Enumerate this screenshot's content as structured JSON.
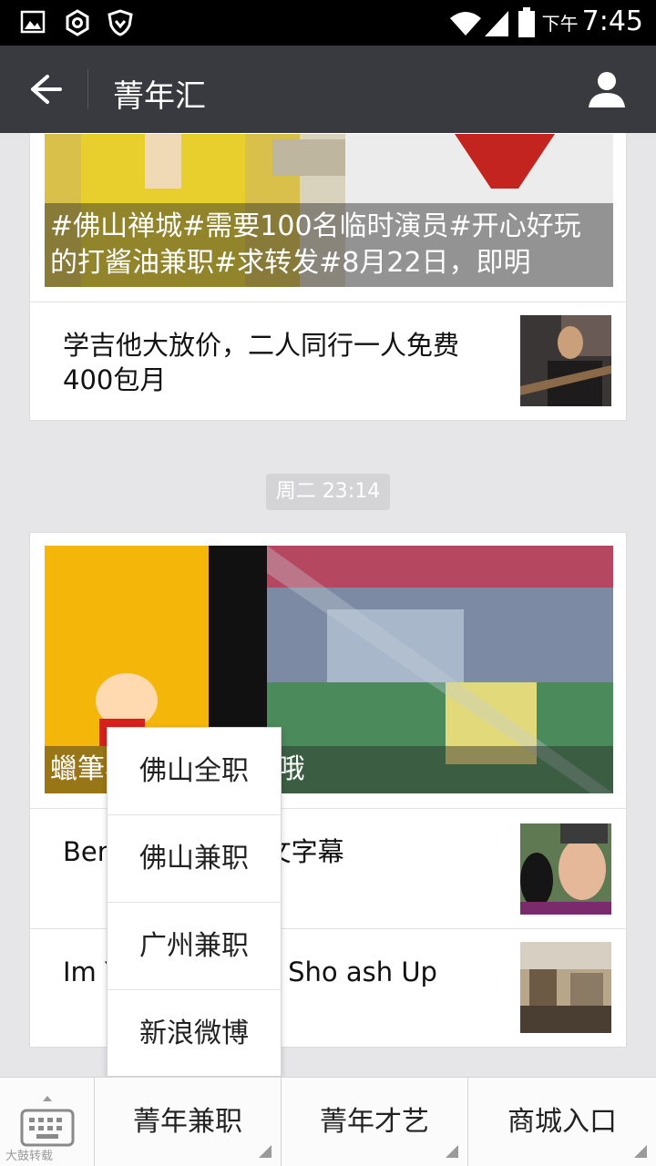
{
  "status_bar": {
    "time": "7:45",
    "period": "下午"
  },
  "header": {
    "title": "菁年汇"
  },
  "feed": {
    "card1": {
      "cover_caption": "#佛山禅城#需要100名临时演员#开心好玩的打酱油兼职#求转发#8月22日，即明",
      "articles": [
        {
          "title": "学吉他大放价，二人同行一人免费400包月"
        }
      ]
    },
    "timestamp": "周二 23:14",
    "card2": {
      "cover_caption": "蠟筆小新 不畏風雨哦",
      "articles": [
        {
          "title": "Ben 綁架跳海(中文字幕"
        },
        {
          "title": "Im Y Mraz & The Sho ash Up"
        }
      ]
    }
  },
  "popup_menu": {
    "items": [
      {
        "label": "佛山全职"
      },
      {
        "label": "佛山兼职"
      },
      {
        "label": "广州兼职"
      },
      {
        "label": "新浪微博"
      }
    ]
  },
  "bottom_menu": {
    "items": [
      {
        "label": "菁年兼职"
      },
      {
        "label": "菁年才艺"
      },
      {
        "label": "商城入口"
      }
    ]
  },
  "watermark": "大鼓转载",
  "colors": {
    "app_bar": "#393a3f",
    "status_bar": "#000000",
    "background": "#e6e6e8"
  },
  "icons": [
    "picture-icon",
    "settings-icon",
    "shield-icon",
    "wifi-icon",
    "signal-icon",
    "battery-icon",
    "back-arrow-icon",
    "profile-icon",
    "keyboard-icon"
  ]
}
